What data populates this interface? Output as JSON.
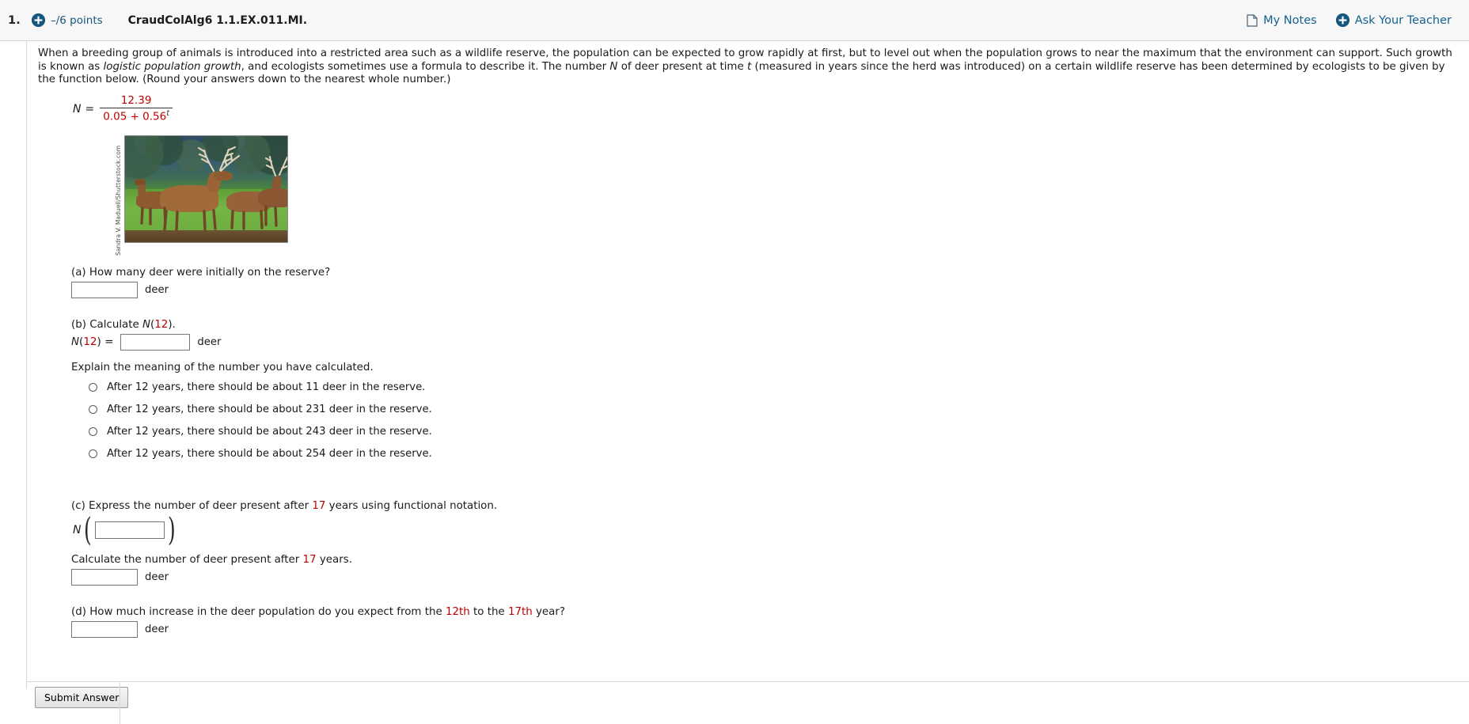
{
  "header": {
    "question_number": "1.",
    "points": "–/6 points",
    "question_code": "CraudColAlg6 1.1.EX.011.MI.",
    "my_notes_label": "My Notes",
    "ask_teacher_label": "Ask Your Teacher",
    "accent_color": "#15577f",
    "link_color": "#15618f"
  },
  "prompt": {
    "p1": "When a breeding group of animals is introduced into a restricted area such as a wildlife reserve, the population can be expected to grow rapidly at first, but to level out when the population grows to near the maximum that the environment can support. Such growth is known as ",
    "emph": "logistic population growth",
    "p2": ", and ecologists sometimes use a formula to describe it. The number ",
    "var_n": "N",
    "p3": " of deer present at time ",
    "var_t": "t",
    "p4": " (measured in years since the herd was introduced) on a certain wildlife reserve has been determined by ecologists to be given by the function below. (Round your answers down to the nearest whole number.)"
  },
  "formula": {
    "lhs": "N",
    "equals": "=",
    "numerator": "12.39",
    "denominator": "0.05 + 0.56",
    "exponent": "t",
    "value_color": "#c00000"
  },
  "figure": {
    "credit": "Sandra V. Maduell/Shutterstock.com",
    "alt": "photograph of a group of deer standing in a grassy wildlife reserve"
  },
  "parts": {
    "a": {
      "label": "(a) How many deer were initially on the reserve?",
      "input_value": "",
      "input_placeholder": "",
      "unit": "deer"
    },
    "b": {
      "label_pre": "(b) Calculate ",
      "label_fn": "N",
      "label_paren_open": "(",
      "label_arg": "12",
      "label_paren_close": ").",
      "eq_fn": "N",
      "eq_paren_open": "(",
      "eq_arg": "12",
      "eq_paren_close": ")",
      "eq_sign": "=",
      "input_value": "",
      "unit": "deer",
      "explain_label": "Explain the meaning of the number you have calculated.",
      "options": [
        "After 12 years, there should be about 11 deer in the reserve.",
        "After 12 years, there should be about 231 deer in the reserve.",
        "After 12 years, there should be about 243 deer in the reserve.",
        "After 12 years, there should be about 254 deer in the reserve."
      ],
      "selected_option": null
    },
    "c": {
      "label_pre": "(c) Express the number of deer present after ",
      "label_years": "17",
      "label_post": " years using functional notation.",
      "fn_name": "N",
      "fn_input_value": "",
      "calc_label_pre": "Calculate the number of deer present after ",
      "calc_label_years": "17",
      "calc_label_post": " years.",
      "calc_input_value": "",
      "unit": "deer"
    },
    "d": {
      "label_pre": "(d) How much increase in the deer population do you expect from the ",
      "label_from": "12th",
      "label_mid": " to the ",
      "label_to": "17th",
      "label_post": " year?",
      "input_value": "",
      "unit": "deer"
    }
  },
  "footer": {
    "submit_label": "Submit Answer"
  }
}
